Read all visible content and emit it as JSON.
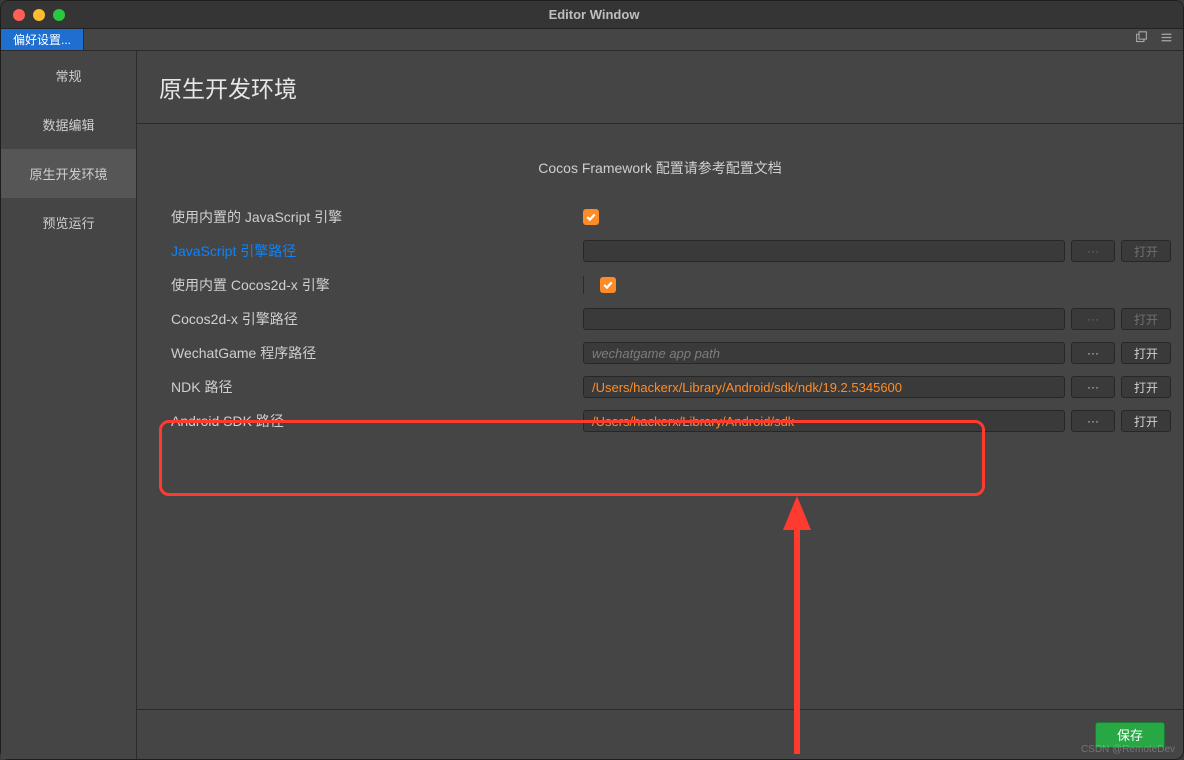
{
  "window": {
    "title": "Editor Window"
  },
  "tab": {
    "label": "偏好设置..."
  },
  "sidebar": {
    "items": [
      {
        "label": "常规"
      },
      {
        "label": "数据编辑"
      },
      {
        "label": "原生开发环境",
        "selected": true
      },
      {
        "label": "预览运行"
      }
    ]
  },
  "page": {
    "title": "原生开发环境",
    "help": "Cocos Framework 配置请参考配置文档"
  },
  "form": {
    "builtin_js_label": "使用内置的 JavaScript 引擎",
    "builtin_js_checked": true,
    "js_path_label": "JavaScript 引擎路径",
    "js_path_value": "",
    "builtin_cocos_label": "使用内置 Cocos2d-x 引擎",
    "builtin_cocos_checked": true,
    "cocos_path_label": "Cocos2d-x 引擎路径",
    "cocos_path_value": "",
    "wechat_label": "WechatGame 程序路径",
    "wechat_placeholder": "wechatgame app path",
    "wechat_value": "",
    "ndk_label": "NDK 路径",
    "ndk_value": "/Users/hackerx/Library/Android/sdk/ndk/19.2.5345600",
    "sdk_label": "Android SDK 路径",
    "sdk_value": "/Users/hackerx/Library/Android/sdk",
    "more_label": "···",
    "open_label": "打开"
  },
  "footer": {
    "save_label": "保存"
  },
  "watermark": "CSDN @RemoteDev"
}
